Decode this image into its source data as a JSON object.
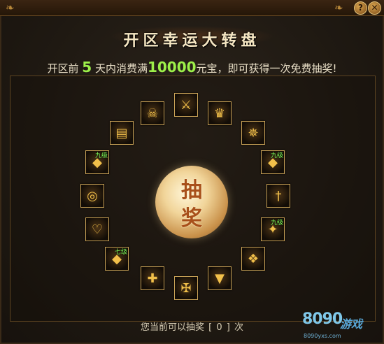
{
  "title": "开区幸运大转盘",
  "description": {
    "prefix": "开区前",
    "days": "5",
    "middle": "天内消费满",
    "amount": "10000",
    "suffix": "元宝，即可获得一次免费抽奖!"
  },
  "header": {
    "help_label": "?",
    "close_label": "✕"
  },
  "draw_button": {
    "line1": "抽",
    "line2": "奖"
  },
  "status": "您当前可以抽奖 [ 0 ] 次",
  "logo": {
    "big": "8090",
    "cn": "游戏",
    "url": "8090yxs.com"
  },
  "items": [
    {
      "name": "skull-helmet",
      "icon": "☠",
      "level": ""
    },
    {
      "name": "sword",
      "icon": "⚔",
      "level": ""
    },
    {
      "name": "golden-crown",
      "icon": "♛",
      "level": ""
    },
    {
      "name": "red-armor",
      "icon": "✵",
      "level": ""
    },
    {
      "name": "gold-armor-level9-right",
      "icon": "◆",
      "level": "九级"
    },
    {
      "name": "dagger",
      "icon": "†",
      "level": ""
    },
    {
      "name": "green-gem-level9",
      "icon": "✦",
      "level": "九级"
    },
    {
      "name": "silver-winged-helmet",
      "icon": "❖",
      "level": ""
    },
    {
      "name": "golden-boots",
      "icon": "▼",
      "level": ""
    },
    {
      "name": "dark-armor",
      "icon": "✠",
      "level": ""
    },
    {
      "name": "cross-staff",
      "icon": "✚",
      "level": ""
    },
    {
      "name": "gold-armor-level7",
      "icon": "◆",
      "level": "七级"
    },
    {
      "name": "silver-helmet",
      "icon": "♡",
      "level": ""
    },
    {
      "name": "red-ring",
      "icon": "◎",
      "level": ""
    },
    {
      "name": "gold-armor-level9-left",
      "icon": "◆",
      "level": "九级"
    },
    {
      "name": "scroll-book",
      "icon": "▤",
      "level": ""
    }
  ]
}
